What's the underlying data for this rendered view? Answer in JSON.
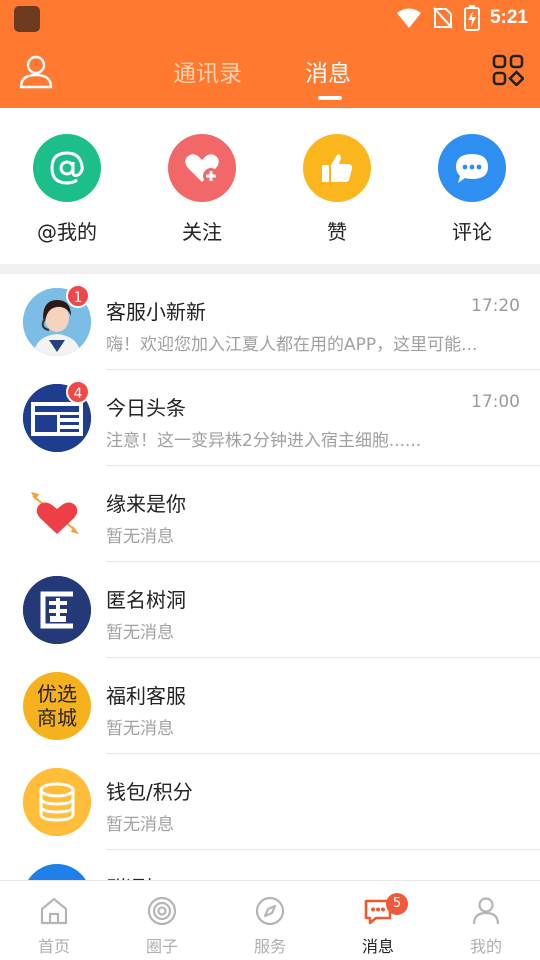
{
  "status_bar": {
    "time": "5:21",
    "icons": [
      "wifi-icon",
      "no-sim-icon",
      "battery-charging-icon"
    ]
  },
  "header": {
    "tabs": [
      {
        "label": "通讯录",
        "active": false
      },
      {
        "label": "消息",
        "active": true
      }
    ],
    "left_icon": "user-icon",
    "right_icon": "scan-grid-icon"
  },
  "quick_actions": [
    {
      "label": "@我的",
      "icon": "at-icon",
      "color": "#1cbf8a"
    },
    {
      "label": "关注",
      "icon": "heart-plus-icon",
      "color": "#f26767"
    },
    {
      "label": "赞",
      "icon": "thumbs-up-icon",
      "color": "#fbb51d"
    },
    {
      "label": "评论",
      "icon": "comment-icon",
      "color": "#2e8ff0"
    }
  ],
  "messages": [
    {
      "title": "客服小新新",
      "subtitle": "嗨！欢迎您加入江夏人都在用的APP，这里可能...",
      "time": "17:20",
      "badge": "1",
      "avatar": "support-agent-avatar"
    },
    {
      "title": "今日头条",
      "subtitle": "注意！这一变异株2分钟进入宿主细胞......",
      "time": "17:00",
      "badge": "4",
      "avatar": "newspaper-avatar"
    },
    {
      "title": "缘来是你",
      "subtitle": "暂无消息",
      "time": "",
      "badge": "",
      "avatar": "heart-arrow-avatar"
    },
    {
      "title": "匿名树洞",
      "subtitle": "暂无消息",
      "time": "",
      "badge": "",
      "avatar": "anonymous-avatar"
    },
    {
      "title": "福利客服",
      "subtitle": "暂无消息",
      "time": "",
      "badge": "",
      "avatar": "mall-avatar",
      "avatar_text_1": "优选",
      "avatar_text_2": "商城"
    },
    {
      "title": "钱包/积分",
      "subtitle": "暂无消息",
      "time": "",
      "badge": "",
      "avatar": "coins-avatar"
    },
    {
      "title": "群通知",
      "subtitle": "",
      "time": "",
      "badge": "",
      "avatar": "group-notice-avatar"
    }
  ],
  "bottom_nav": [
    {
      "label": "首页",
      "icon": "home-icon",
      "active": false
    },
    {
      "label": "圈子",
      "icon": "circle-icon",
      "active": false
    },
    {
      "label": "服务",
      "icon": "compass-icon",
      "active": false
    },
    {
      "label": "消息",
      "icon": "message-icon",
      "active": true,
      "badge": "5"
    },
    {
      "label": "我的",
      "icon": "profile-icon",
      "active": false
    }
  ],
  "colors": {
    "brand": "#ff7a30",
    "badge": "#f04848"
  }
}
